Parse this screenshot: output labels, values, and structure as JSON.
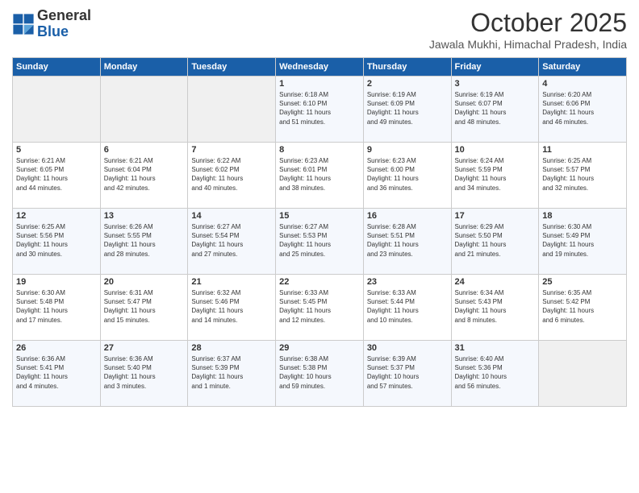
{
  "header": {
    "logo_line1": "General",
    "logo_line2": "Blue",
    "month": "October 2025",
    "location": "Jawala Mukhi, Himachal Pradesh, India"
  },
  "days_of_week": [
    "Sunday",
    "Monday",
    "Tuesday",
    "Wednesday",
    "Thursday",
    "Friday",
    "Saturday"
  ],
  "weeks": [
    [
      {
        "num": "",
        "info": ""
      },
      {
        "num": "",
        "info": ""
      },
      {
        "num": "",
        "info": ""
      },
      {
        "num": "1",
        "info": "Sunrise: 6:18 AM\nSunset: 6:10 PM\nDaylight: 11 hours\nand 51 minutes."
      },
      {
        "num": "2",
        "info": "Sunrise: 6:19 AM\nSunset: 6:09 PM\nDaylight: 11 hours\nand 49 minutes."
      },
      {
        "num": "3",
        "info": "Sunrise: 6:19 AM\nSunset: 6:07 PM\nDaylight: 11 hours\nand 48 minutes."
      },
      {
        "num": "4",
        "info": "Sunrise: 6:20 AM\nSunset: 6:06 PM\nDaylight: 11 hours\nand 46 minutes."
      }
    ],
    [
      {
        "num": "5",
        "info": "Sunrise: 6:21 AM\nSunset: 6:05 PM\nDaylight: 11 hours\nand 44 minutes."
      },
      {
        "num": "6",
        "info": "Sunrise: 6:21 AM\nSunset: 6:04 PM\nDaylight: 11 hours\nand 42 minutes."
      },
      {
        "num": "7",
        "info": "Sunrise: 6:22 AM\nSunset: 6:02 PM\nDaylight: 11 hours\nand 40 minutes."
      },
      {
        "num": "8",
        "info": "Sunrise: 6:23 AM\nSunset: 6:01 PM\nDaylight: 11 hours\nand 38 minutes."
      },
      {
        "num": "9",
        "info": "Sunrise: 6:23 AM\nSunset: 6:00 PM\nDaylight: 11 hours\nand 36 minutes."
      },
      {
        "num": "10",
        "info": "Sunrise: 6:24 AM\nSunset: 5:59 PM\nDaylight: 11 hours\nand 34 minutes."
      },
      {
        "num": "11",
        "info": "Sunrise: 6:25 AM\nSunset: 5:57 PM\nDaylight: 11 hours\nand 32 minutes."
      }
    ],
    [
      {
        "num": "12",
        "info": "Sunrise: 6:25 AM\nSunset: 5:56 PM\nDaylight: 11 hours\nand 30 minutes."
      },
      {
        "num": "13",
        "info": "Sunrise: 6:26 AM\nSunset: 5:55 PM\nDaylight: 11 hours\nand 28 minutes."
      },
      {
        "num": "14",
        "info": "Sunrise: 6:27 AM\nSunset: 5:54 PM\nDaylight: 11 hours\nand 27 minutes."
      },
      {
        "num": "15",
        "info": "Sunrise: 6:27 AM\nSunset: 5:53 PM\nDaylight: 11 hours\nand 25 minutes."
      },
      {
        "num": "16",
        "info": "Sunrise: 6:28 AM\nSunset: 5:51 PM\nDaylight: 11 hours\nand 23 minutes."
      },
      {
        "num": "17",
        "info": "Sunrise: 6:29 AM\nSunset: 5:50 PM\nDaylight: 11 hours\nand 21 minutes."
      },
      {
        "num": "18",
        "info": "Sunrise: 6:30 AM\nSunset: 5:49 PM\nDaylight: 11 hours\nand 19 minutes."
      }
    ],
    [
      {
        "num": "19",
        "info": "Sunrise: 6:30 AM\nSunset: 5:48 PM\nDaylight: 11 hours\nand 17 minutes."
      },
      {
        "num": "20",
        "info": "Sunrise: 6:31 AM\nSunset: 5:47 PM\nDaylight: 11 hours\nand 15 minutes."
      },
      {
        "num": "21",
        "info": "Sunrise: 6:32 AM\nSunset: 5:46 PM\nDaylight: 11 hours\nand 14 minutes."
      },
      {
        "num": "22",
        "info": "Sunrise: 6:33 AM\nSunset: 5:45 PM\nDaylight: 11 hours\nand 12 minutes."
      },
      {
        "num": "23",
        "info": "Sunrise: 6:33 AM\nSunset: 5:44 PM\nDaylight: 11 hours\nand 10 minutes."
      },
      {
        "num": "24",
        "info": "Sunrise: 6:34 AM\nSunset: 5:43 PM\nDaylight: 11 hours\nand 8 minutes."
      },
      {
        "num": "25",
        "info": "Sunrise: 6:35 AM\nSunset: 5:42 PM\nDaylight: 11 hours\nand 6 minutes."
      }
    ],
    [
      {
        "num": "26",
        "info": "Sunrise: 6:36 AM\nSunset: 5:41 PM\nDaylight: 11 hours\nand 4 minutes."
      },
      {
        "num": "27",
        "info": "Sunrise: 6:36 AM\nSunset: 5:40 PM\nDaylight: 11 hours\nand 3 minutes."
      },
      {
        "num": "28",
        "info": "Sunrise: 6:37 AM\nSunset: 5:39 PM\nDaylight: 11 hours\nand 1 minute."
      },
      {
        "num": "29",
        "info": "Sunrise: 6:38 AM\nSunset: 5:38 PM\nDaylight: 10 hours\nand 59 minutes."
      },
      {
        "num": "30",
        "info": "Sunrise: 6:39 AM\nSunset: 5:37 PM\nDaylight: 10 hours\nand 57 minutes."
      },
      {
        "num": "31",
        "info": "Sunrise: 6:40 AM\nSunset: 5:36 PM\nDaylight: 10 hours\nand 56 minutes."
      },
      {
        "num": "",
        "info": ""
      }
    ]
  ]
}
